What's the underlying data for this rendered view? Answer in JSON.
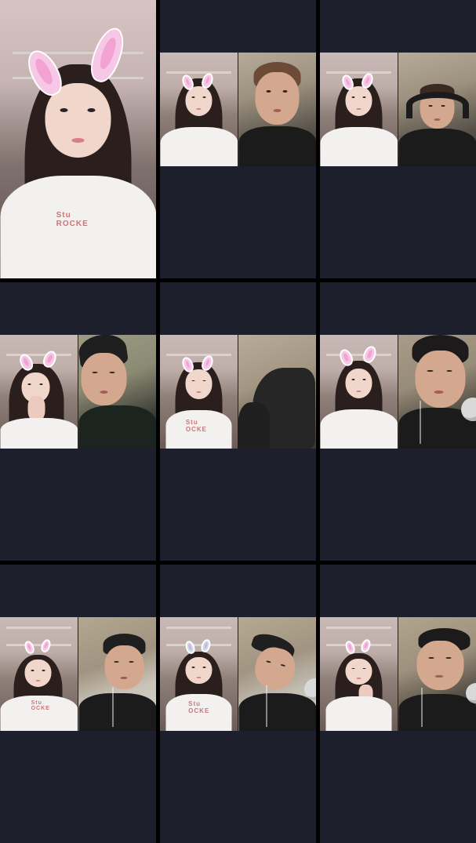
{
  "screen": {
    "title": "",
    "grid_rows": 3,
    "grid_cols": 3
  },
  "colors": {
    "cell_background": "#1e1f2d",
    "divider": "#000000",
    "bunny_ear_pink": "#f7c7e6",
    "shirt_print": "#c04a52"
  },
  "cells": [
    {
      "id": "r1c1",
      "type": "single-video",
      "shirt_text": "Stu\nROCKE"
    },
    {
      "id": "r1c2",
      "type": "duet-video"
    },
    {
      "id": "r1c3",
      "type": "duet-video"
    },
    {
      "id": "r2c1",
      "type": "duet-video"
    },
    {
      "id": "r2c2",
      "type": "duet-video",
      "shirt_text": "Stu\nOCKE"
    },
    {
      "id": "r2c3",
      "type": "duet-video"
    },
    {
      "id": "r3c1",
      "type": "duet-video",
      "shirt_text": "Stu\nOCKE"
    },
    {
      "id": "r3c2",
      "type": "duet-video",
      "shirt_text": "Stu\nOCKE"
    },
    {
      "id": "r3c3",
      "type": "duet-video"
    }
  ],
  "icons": [
    "bunny-ears-filter-icon",
    "headphones-icon",
    "microphone-icon",
    "baseball-cap-icon"
  ]
}
